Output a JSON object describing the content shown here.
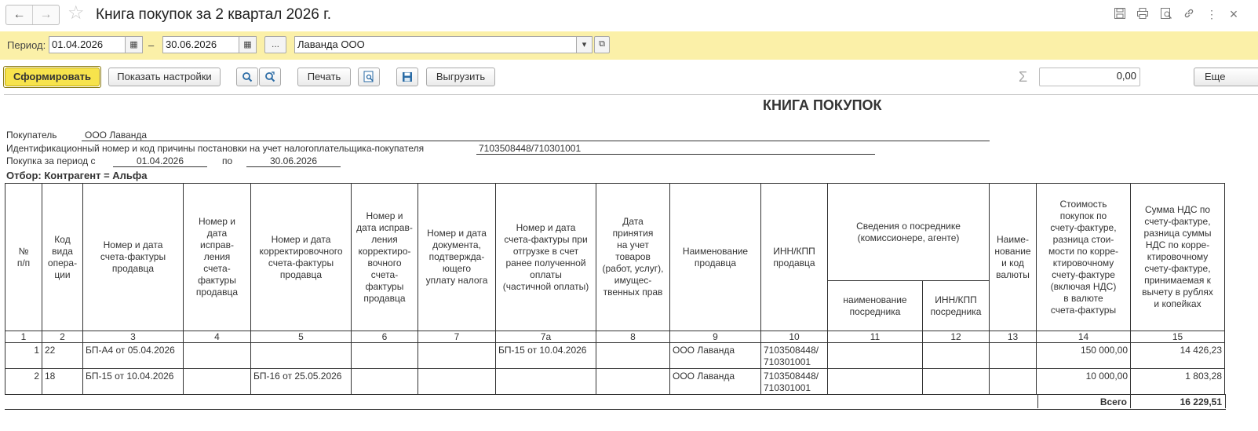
{
  "window": {
    "title": "Книга покупок за 2 квартал 2026 г.",
    "back_icon": "←",
    "forward_icon": "→"
  },
  "period_bar": {
    "label": "Период:",
    "date_from": "01.04.2026",
    "dash": "–",
    "date_to": "30.06.2026",
    "ellipsis": "...",
    "organization": "Лаванда ООО"
  },
  "toolbar": {
    "generate": "Сформировать",
    "show_settings": "Показать настройки",
    "print": "Печать",
    "export": "Выгрузить",
    "sum_value": "0,00",
    "more": "Еще"
  },
  "report": {
    "title": "КНИГА ПОКУПОК",
    "buyer_label": "Покупатель",
    "buyer_value": "ООО Лаванда",
    "inn_label": "Идентификационный номер и код причины постановки на учет налогоплательщика-покупателя",
    "inn_value": "7103508448/710301001",
    "period_label": "Покупка за период с",
    "period_from": "01.04.2026",
    "period_to_label": "по",
    "period_to": "30.06.2026",
    "filter": "Отбор: Контрагент = Альфа",
    "headers": {
      "c1": "№\nп/п",
      "c2": "Код\nвида\nопера-\nции",
      "c3": "Номер и дата\nсчета-фактуры\nпродавца",
      "c4": "Номер и\nдата\nисправ-\nления\nсчета-\nфактуры\nпродавца",
      "c5": "Номер и дата\nкорректировочного\nсчета-фактуры\nпродавца",
      "c6": "Номер и\nдата исправ-\nления\nкорректиро-\nвочного\nсчета-\nфактуры\nпродавца",
      "c7": "Номер и дата\nдокумента,\nподтвержда-\nющего\nуплату налога",
      "c7a": "Номер и дата\nсчета-фактуры при\nотгрузке в счет\nранее полученной\nоплаты\n(частичной оплаты)",
      "c8": "Дата\nпринятия\nна учет\nтоваров\n(работ, услуг),\nимущес-\nтвенных прав",
      "c9": "Наименование\nпродавца",
      "c10": "ИНН/КПП\nпродавца",
      "c11_12": "Сведения о посреднике\n(комиссионере, агенте)",
      "c11": "наименование\nпосредника",
      "c12": "ИНН/КПП\nпосредника",
      "c13": "Наиме-\nнование\nи код\nвалюты",
      "c14": "Стоимость\nпокупок по\nсчету-фактуре,\nразница стои-\nмости по корре-\nктировочному\nсчету-фактуре\n(включая НДС)\nв валюте\nсчета-фактуры",
      "c15": "Сумма НДС по\nсчету-фактуре,\nразница суммы\nНДС по корре-\nктировочному\nсчету-фактуре,\nпринимаемая к\nвычету в рублях\nи копейках"
    },
    "numbers": [
      "1",
      "2",
      "3",
      "4",
      "5",
      "6",
      "7",
      "7а",
      "8",
      "9",
      "10",
      "11",
      "12",
      "13",
      "14",
      "15"
    ],
    "rows": [
      {
        "n": "1",
        "code": "22",
        "invoice": "БП-А4 от 05.04.2026",
        "fix": "",
        "corr": "",
        "corr_fix": "",
        "payment_doc": "",
        "advance_invoice": "БП-15 от 10.04.2026",
        "accept_date": "",
        "seller": "ООО Лаванда",
        "seller_inn": "7103508448/\n710301001",
        "agent": "",
        "agent_inn": "",
        "currency": "",
        "cost": "150 000,00",
        "vat": "14 426,23"
      },
      {
        "n": "2",
        "code": "18",
        "invoice": "БП-15 от 10.04.2026",
        "fix": "",
        "corr": "БП-16 от 25.05.2026",
        "corr_fix": "",
        "payment_doc": "",
        "advance_invoice": "",
        "accept_date": "",
        "seller": "ООО Лаванда",
        "seller_inn": "7103508448/\n710301001",
        "agent": "",
        "agent_inn": "",
        "currency": "",
        "cost": "10 000,00",
        "vat": "1 803,28"
      }
    ],
    "total_label": "Всего",
    "total_value": "16 229,51"
  }
}
